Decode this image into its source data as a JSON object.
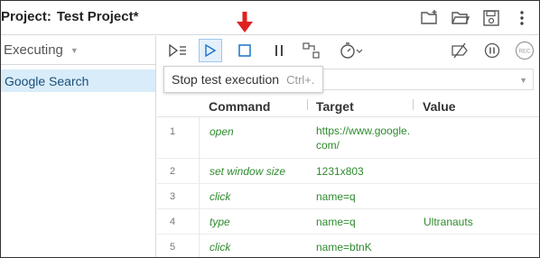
{
  "project": {
    "label": "Project:",
    "name": "Test Project*"
  },
  "left_panel": {
    "section": "Executing",
    "tests": [
      "Google Search"
    ]
  },
  "tooltip": {
    "text": "Stop test execution",
    "shortcut": "Ctrl+."
  },
  "table": {
    "headers": {
      "command": "Command",
      "target": "Target",
      "value": "Value"
    },
    "rows": [
      {
        "num": "1",
        "command": "open",
        "target": "https://www.google.com/",
        "value": ""
      },
      {
        "num": "2",
        "command": "set window size",
        "target": "1231x803",
        "value": ""
      },
      {
        "num": "3",
        "command": "click",
        "target": "name=q",
        "value": ""
      },
      {
        "num": "4",
        "command": "type",
        "target": "name=q",
        "value": "Ultranauts"
      },
      {
        "num": "5",
        "command": "click",
        "target": "name=btnK",
        "value": ""
      }
    ]
  },
  "colors": {
    "accent": "#1a73c8",
    "arrow": "#e02020",
    "command_text": "#2e8a2e",
    "selected_row": "#d9ecf9"
  },
  "icons": {
    "header": [
      "new-folder-icon",
      "open-folder-icon",
      "save-icon",
      "more-vert-icon"
    ],
    "toolbar": [
      "run-all-icon",
      "run-current-icon",
      "stop-icon",
      "pause-icon",
      "step-icon",
      "speed-icon",
      "disable-breakpoints-icon",
      "pause-on-exception-icon",
      "record-icon"
    ]
  }
}
